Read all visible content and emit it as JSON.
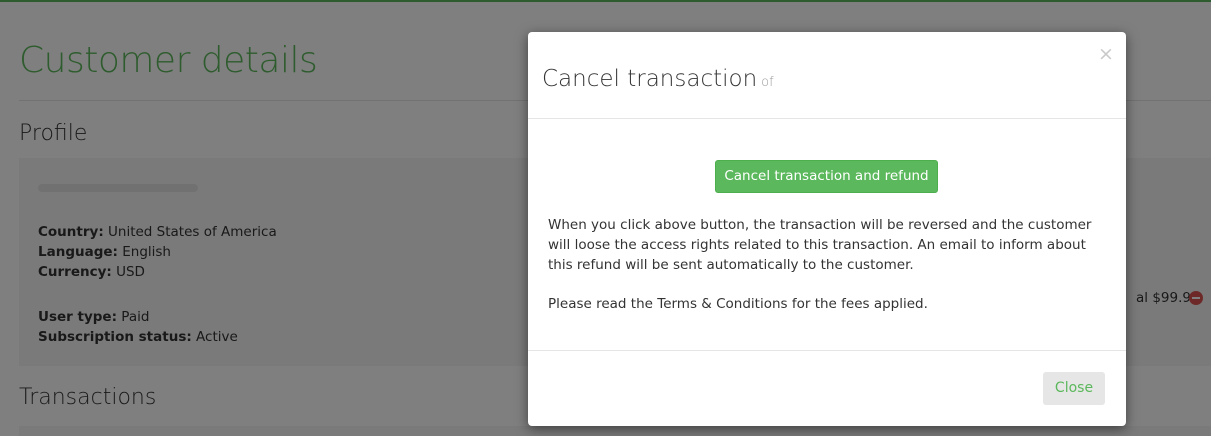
{
  "page": {
    "title": "Customer details",
    "profile_heading": "Profile",
    "transactions_heading": "Transactions",
    "accent_color": "#5cb85c"
  },
  "profile": {
    "country_label": "Country:",
    "country_value": "United States of America",
    "language_label": "Language:",
    "language_value": "English",
    "currency_label": "Currency:",
    "currency_value": "USD",
    "user_type_label": "User type:",
    "user_type_value": "Paid",
    "subscription_label": "Subscription status:",
    "subscription_value": "Active",
    "total_text": "al $99.99",
    "remove_icon": "minus-circle-icon",
    "remove_color": "#d9534f"
  },
  "modal": {
    "title": "Cancel transaction",
    "title_suffix": "of",
    "close_symbol": "×",
    "refund_button": "Cancel transaction and refund",
    "paragraph": "When you click above button, the transaction will be reversed and the customer will loose the access rights related to this transaction. An email to inform about this refund will be sent automatically to the customer.",
    "note": "Please read the Terms & Conditions for the fees applied.",
    "close_button": "Close"
  }
}
